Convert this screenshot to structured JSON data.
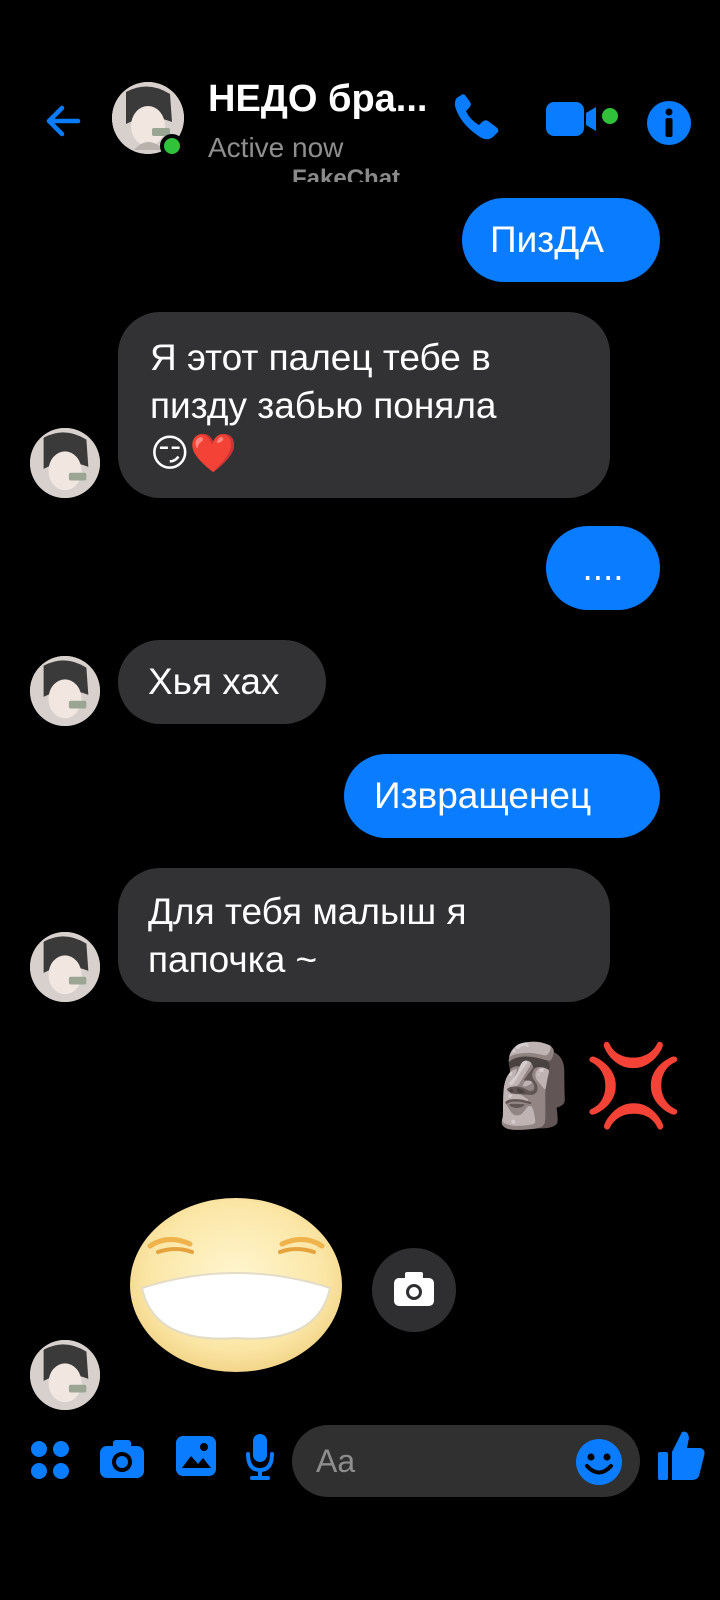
{
  "header": {
    "contact_name": "НЕДО бра...",
    "status": "Active now",
    "watermark": "FakeChat"
  },
  "messages": [
    {
      "side": "sent",
      "text": "ПизДА"
    },
    {
      "side": "received",
      "text": "Я этот палец тебе в пизду забью поняла",
      "emoji": "😏❤️"
    },
    {
      "side": "sent",
      "text": "...."
    },
    {
      "side": "received",
      "text": "Хья хах"
    },
    {
      "side": "sent",
      "text": "Извращенец"
    },
    {
      "side": "received",
      "text": "Для тебя малыш я папочка ~"
    },
    {
      "side": "sent",
      "emoji": "🗿💢"
    }
  ],
  "composer": {
    "placeholder": "Aa"
  },
  "colors": {
    "accent": "#0a7cff",
    "received_bubble": "#323234",
    "online": "#31c23b",
    "background": "#000000"
  },
  "icons": [
    "back-arrow-icon",
    "phone-icon",
    "video-icon",
    "info-icon",
    "menu-dots-icon",
    "camera-icon",
    "gallery-icon",
    "microphone-icon",
    "emoji-icon",
    "thumbs-up-icon"
  ]
}
